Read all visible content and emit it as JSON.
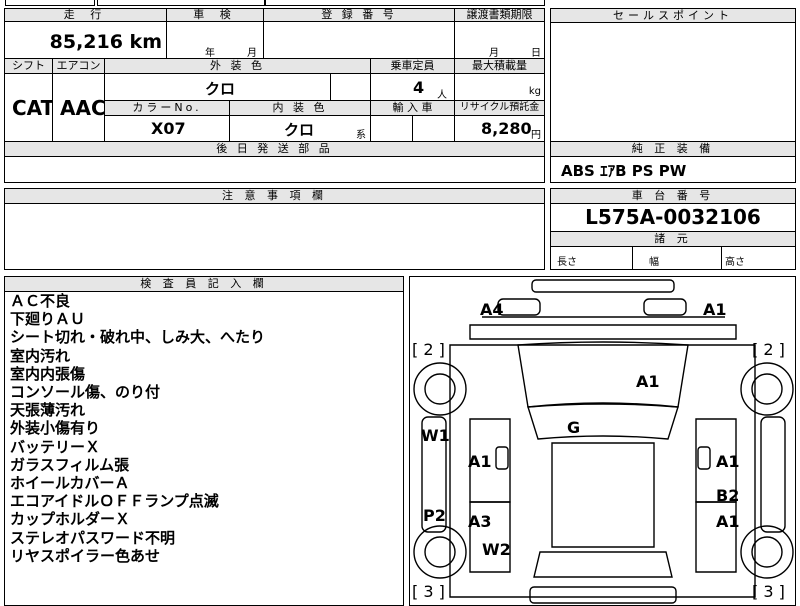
{
  "header": {
    "mileage_label": "走 行",
    "inspection_label": "車 検",
    "registration_label": "登 録 番 号",
    "transfer_label": "譲渡書類期限",
    "sales_point_label": "セールスポイント",
    "mileage_value": "85,216 km",
    "inspection_year": "年",
    "inspection_month": "月",
    "transfer_month": "月",
    "transfer_day": "日"
  },
  "specs": {
    "shift_label": "シフト",
    "aircon_label": "エアコン",
    "ext_color_label": "外 装 色",
    "capacity_label": "乗車定員",
    "max_load_label": "最大積載量",
    "shift_value": "CAT",
    "aircon_value": "AAC",
    "ext_color_value": "クロ",
    "capacity_value": "4",
    "capacity_unit": "人",
    "load_unit": "kg",
    "color_no_label": "カラーNo.",
    "int_color_label": "内 装 色",
    "import_label": "輸 入 車",
    "recycle_label": "リサイクル預託金",
    "color_no_value": "X07",
    "int_color_value": "クロ",
    "int_color_suffix": "系",
    "recycle_value": "8,280",
    "recycle_unit": "円",
    "later_parts_label": "後 日 発 送 部 品"
  },
  "genuine": {
    "label": "純 正 装 備",
    "value": "ABS ｴｱB PS PW"
  },
  "caution": {
    "label": "注 意 事 項 欄"
  },
  "chassis": {
    "label": "車 台 番 号",
    "value": "L575A-0032106",
    "dims_label": "諸 元",
    "length_label": "長さ",
    "width_label": "幅",
    "height_label": "高さ"
  },
  "inspector": {
    "label": "検 査 員 記 入 欄",
    "notes": [
      "ＡＣ不良",
      "下廻りＡＵ",
      "シート切れ・破れ中、しみ大、へたり",
      "室内汚れ",
      "室内内張傷",
      "コンソール傷、のり付",
      "天張薄汚れ",
      "外装小傷有り",
      "バッテリーＸ",
      "ガラスフィルム張",
      "ホイールカバーＡ",
      "エコアイドルＯＦＦランプ点滅",
      "カップホルダーＸ",
      "ステレオパスワード不明",
      "リヤスポイラー色あせ"
    ]
  },
  "diagram": {
    "marks": {
      "a4": "A4",
      "a1_front_right": "A1",
      "tire_left_front": "[ 2 ]",
      "tire_right_front": "[ 2 ]",
      "a1_hood": "A1",
      "w1": "W1",
      "g": "G",
      "a1_left_door": "A1",
      "a1_right_door": "A1",
      "b2": "B2",
      "p2": "P2",
      "a3": "A3",
      "a1_right_rear": "A1",
      "w2": "W2",
      "tire_left_rear": "[ 3 ]",
      "tire_right_rear": "[ 3 ]"
    }
  }
}
